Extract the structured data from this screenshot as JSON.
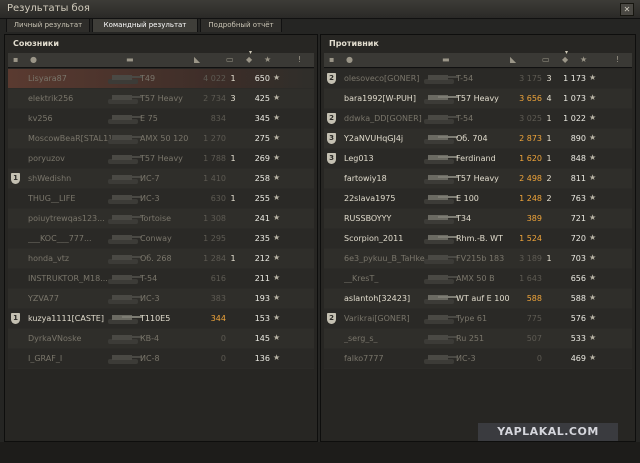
{
  "window": {
    "title": "Результаты боя",
    "close": "✕"
  },
  "tabs": [
    {
      "label": "Личный результат",
      "active": false
    },
    {
      "label": "Командный результат",
      "active": true
    },
    {
      "label": "Подробный отчёт",
      "active": false
    }
  ],
  "allies": {
    "title": "Союзники",
    "headers": {
      "platoon": "platoon-icon",
      "player": "player-icon",
      "tank": "tank-icon",
      "damage": "damage-icon",
      "frags": "frags-icon",
      "xp": "xp-icon",
      "medal": "medal-icon"
    },
    "rows": [
      {
        "platoon": "",
        "player": "Lisyara87",
        "tank": "T49",
        "damage": "4 022",
        "frags": "1",
        "xp": "650",
        "me": true,
        "dead": true
      },
      {
        "platoon": "",
        "player": "elektrik256",
        "tank": "T57 Heavy",
        "damage": "2 734",
        "frags": "3",
        "xp": "425",
        "me": false,
        "dead": true
      },
      {
        "platoon": "",
        "player": "kv256",
        "tank": "E 75",
        "damage": "834",
        "frags": "",
        "xp": "345",
        "me": false,
        "dead": true
      },
      {
        "platoon": "",
        "player": "MoscowBeaR[STAL1]",
        "tank": "AMX 50 120",
        "damage": "1 270",
        "frags": "",
        "xp": "275",
        "me": false,
        "dead": true
      },
      {
        "platoon": "",
        "player": "poryuzov",
        "tank": "T57 Heavy",
        "damage": "1 788",
        "frags": "1",
        "xp": "269",
        "me": false,
        "dead": true
      },
      {
        "platoon": "1",
        "player": "shWedishn",
        "tank": "ИС-7",
        "damage": "1 410",
        "frags": "",
        "xp": "258",
        "me": false,
        "dead": true
      },
      {
        "platoon": "",
        "player": "THUG__LIFE",
        "tank": "ИС-3",
        "damage": "630",
        "frags": "1",
        "xp": "255",
        "me": false,
        "dead": true
      },
      {
        "platoon": "",
        "player": "poiuytrewqas123...",
        "tank": "Tortoise",
        "damage": "1 308",
        "frags": "",
        "xp": "241",
        "me": false,
        "dead": true
      },
      {
        "platoon": "",
        "player": "___KOC___777...",
        "tank": "Conway",
        "damage": "1 295",
        "frags": "",
        "xp": "235",
        "me": false,
        "dead": true
      },
      {
        "platoon": "",
        "player": "honda_vtz",
        "tank": "Об. 268",
        "damage": "1 284",
        "frags": "1",
        "xp": "212",
        "me": false,
        "dead": true
      },
      {
        "platoon": "",
        "player": "INSTRUKTOR_M18...",
        "tank": "T-54",
        "damage": "616",
        "frags": "",
        "xp": "211",
        "me": false,
        "dead": true
      },
      {
        "platoon": "",
        "player": "YZVA77",
        "tank": "ИС-3",
        "damage": "383",
        "frags": "",
        "xp": "193",
        "me": false,
        "dead": true
      },
      {
        "platoon": "1",
        "player": "kuzya1111[CASTE]",
        "tank": "T110E5",
        "damage": "344",
        "frags": "",
        "xp": "153",
        "me": false,
        "dead": false
      },
      {
        "platoon": "",
        "player": "DyrkaVNoske",
        "tank": "КВ-4",
        "damage": "0",
        "frags": "",
        "xp": "145",
        "me": false,
        "dead": true
      },
      {
        "platoon": "",
        "player": "I_GRAF_I",
        "tank": "ИС-8",
        "damage": "0",
        "frags": "",
        "xp": "136",
        "me": false,
        "dead": true
      }
    ]
  },
  "enemies": {
    "title": "Противник",
    "rows": [
      {
        "platoon": "2",
        "player": "olesoveco[GONER]",
        "tank": "T-54",
        "damage": "3 175",
        "frags": "3",
        "xp": "1 173",
        "dead": true
      },
      {
        "platoon": "",
        "player": "bara1992[W-PUH]",
        "tank": "T57 Heavy",
        "damage": "3 656",
        "frags": "4",
        "xp": "1 073",
        "dead": false
      },
      {
        "platoon": "2",
        "player": "ddwka_DD[GONER]",
        "tank": "T-54",
        "damage": "3 025",
        "frags": "1",
        "xp": "1 022",
        "dead": true
      },
      {
        "platoon": "3",
        "player": "Y2aNVUHqGJ4j",
        "tank": "Об. 704",
        "damage": "2 873",
        "frags": "1",
        "xp": "890",
        "dead": false
      },
      {
        "platoon": "3",
        "player": "Leg013",
        "tank": "Ferdinand",
        "damage": "1 620",
        "frags": "1",
        "xp": "848",
        "dead": false
      },
      {
        "platoon": "",
        "player": "fartowiy18",
        "tank": "T57 Heavy",
        "damage": "2 498",
        "frags": "2",
        "xp": "811",
        "dead": false
      },
      {
        "platoon": "",
        "player": "22slava1975",
        "tank": "E 100",
        "damage": "1 248",
        "frags": "2",
        "xp": "763",
        "dead": false
      },
      {
        "platoon": "",
        "player": "RUSSBOYYY",
        "tank": "T34",
        "damage": "389",
        "frags": "",
        "xp": "721",
        "dead": false
      },
      {
        "platoon": "",
        "player": "Scorpion_2011",
        "tank": "Rhm.-B. WT",
        "damage": "1 524",
        "frags": "",
        "xp": "720",
        "dead": false
      },
      {
        "platoon": "",
        "player": "6e3_pykuu_B_TaHke...",
        "tank": "FV215b 183",
        "damage": "3 189",
        "frags": "1",
        "xp": "703",
        "dead": true
      },
      {
        "platoon": "",
        "player": "__KresT_",
        "tank": "AMX 50 B",
        "damage": "1 643",
        "frags": "",
        "xp": "656",
        "dead": true
      },
      {
        "platoon": "",
        "player": "aslantoh[32423]",
        "tank": "WT auf E 100",
        "damage": "588",
        "frags": "",
        "xp": "588",
        "dead": false
      },
      {
        "platoon": "2",
        "player": "Varikrai[GONER]",
        "tank": "Type 61",
        "damage": "775",
        "frags": "",
        "xp": "576",
        "dead": true
      },
      {
        "platoon": "",
        "player": "_serg_s_",
        "tank": "Ru 251",
        "damage": "507",
        "frags": "",
        "xp": "533",
        "dead": true
      },
      {
        "platoon": "",
        "player": "falko7777",
        "tank": "ИС-3",
        "damage": "0",
        "frags": "",
        "xp": "469",
        "dead": true
      }
    ]
  },
  "watermark": "YAPLAKAL.COM",
  "colors": {
    "damage": "#f0a53a",
    "me_row": "#5a3a30",
    "alive_text": "#e0dbcc",
    "dead_text": "#7a766b"
  }
}
